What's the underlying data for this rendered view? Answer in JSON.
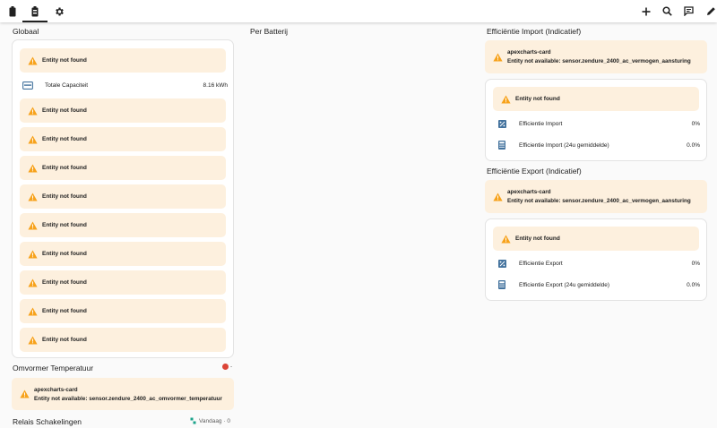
{
  "toolbar": {
    "tabs": [
      {
        "icon": "battery-icon"
      },
      {
        "icon": "battery-active-icon"
      },
      {
        "icon": "gear-icon"
      }
    ],
    "actions": [
      {
        "icon": "plus-icon"
      },
      {
        "icon": "search-icon"
      },
      {
        "icon": "chat-icon"
      },
      {
        "icon": "pencil-icon"
      }
    ]
  },
  "columns": {
    "globaal": {
      "title": "Globaal",
      "first_warning": "Entity not found",
      "capacity": {
        "label": "Totale Capaciteit",
        "value": "8.16 kWh"
      },
      "warnings": [
        "Entity not found",
        "Entity not found",
        "Entity not found",
        "Entity not found",
        "Entity not found",
        "Entity not found",
        "Entity not found",
        "Entity not found",
        "Entity not found"
      ]
    },
    "omvormer": {
      "title": "Omvormer Temperatuur",
      "badge": "-",
      "card_title": "apexcharts-card",
      "card_error": "Entity not available: sensor.zendure_2400_ac_omvormer_temperatuur"
    },
    "relais": {
      "title": "Relais Schakelingen",
      "badge_label": "Vandaag · 0"
    },
    "per_batterij": {
      "title": "Per Batterij"
    },
    "import": {
      "title": "Efficiëntie Import (Indicatief)",
      "card_title": "apexcharts-card",
      "card_error": "Entity not available: sensor.zendure_2400_ac_vermogen_aansturing",
      "warning": "Entity not found",
      "rows": [
        {
          "label": "Efficientie Import",
          "value": "0%",
          "icon": "percent-icon"
        },
        {
          "label": "Efficientie Import (24u gemiddelde)",
          "value": "0.0%",
          "icon": "calculator-icon"
        }
      ]
    },
    "export": {
      "title": "Efficiëntie Export (Indicatief)",
      "card_title": "apexcharts-card",
      "card_error": "Entity not available: sensor.zendure_2400_ac_vermogen_aansturing",
      "warning": "Entity not found",
      "rows": [
        {
          "label": "Efficientie Export",
          "value": "0%",
          "icon": "percent-icon"
        },
        {
          "label": "Efficientie Export (24u gemiddelde)",
          "value": "0.0%",
          "icon": "calculator-icon"
        }
      ]
    }
  },
  "colors": {
    "warning_bg": "#fdf0de",
    "warning_icon": "#f7a21b",
    "error_dot": "#db4437",
    "accent_blue": "#44739e",
    "relais_icon": "#1aa38a"
  }
}
